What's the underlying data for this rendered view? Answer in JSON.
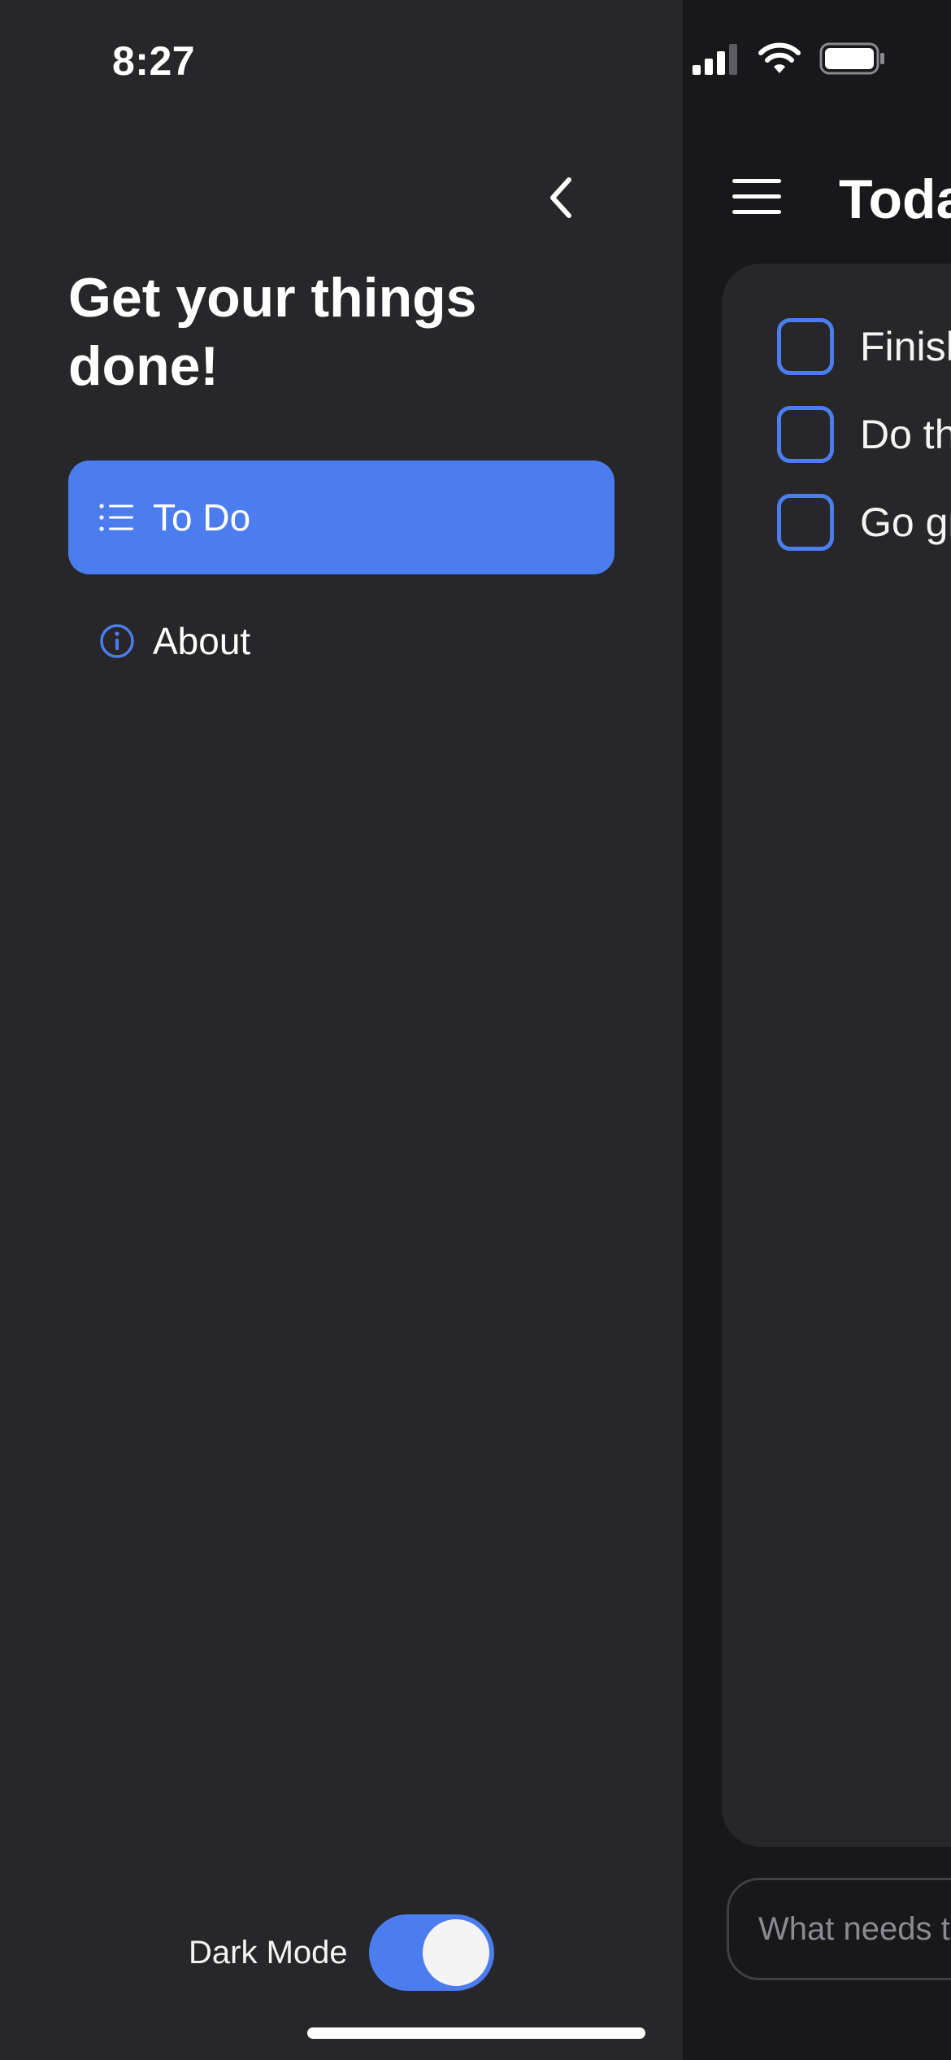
{
  "status_bar": {
    "time": "8:27",
    "icons": [
      "cellular-signal-icon",
      "wifi-icon",
      "battery-icon"
    ]
  },
  "drawer": {
    "title": "Get your things done!",
    "back_icon": "chevron-left-icon",
    "nav": [
      {
        "label": "To Do",
        "icon": "list-icon",
        "active": true
      },
      {
        "label": "About",
        "icon": "info-icon",
        "active": false
      }
    ],
    "dark_mode": {
      "label": "Dark Mode",
      "enabled": true
    }
  },
  "main": {
    "menu_icon": "hamburger-menu-icon",
    "title": "Toda",
    "todos": [
      {
        "text": "Finish",
        "checked": false
      },
      {
        "text": "Do th",
        "checked": false
      },
      {
        "text": "Go gr",
        "checked": false
      }
    ],
    "input": {
      "placeholder": "What needs t",
      "value": ""
    }
  },
  "colors": {
    "accent": "#4b7def",
    "drawer_bg": "#27272a",
    "screen_bg": "#18181b",
    "text": "#ffffff"
  }
}
